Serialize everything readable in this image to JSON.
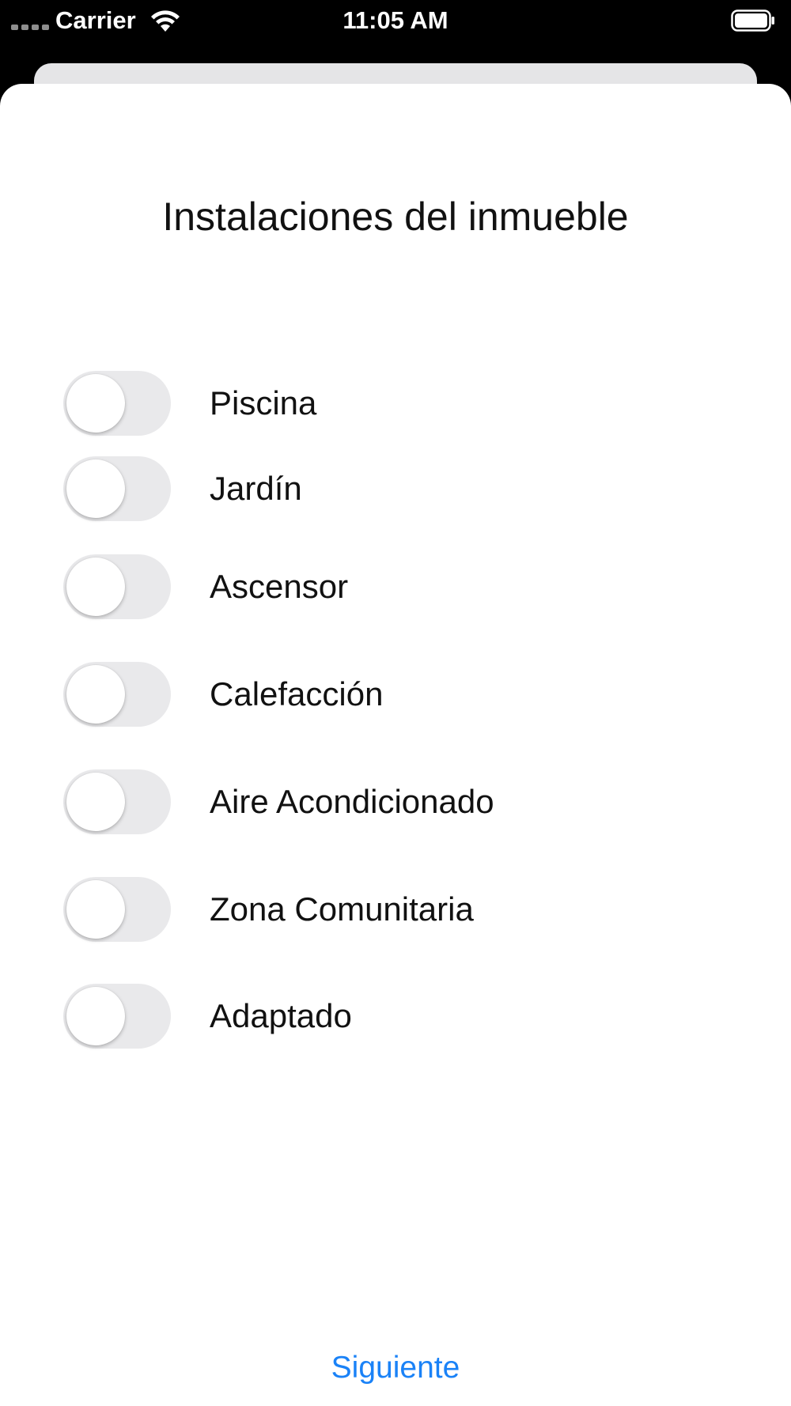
{
  "status_bar": {
    "carrier": "Carrier",
    "time": "11:05 AM",
    "icons": [
      "signal-dots-icon",
      "wifi-icon",
      "battery-icon"
    ]
  },
  "sheet": {
    "title": "Instalaciones del inmueble",
    "toggles": [
      {
        "label": "Piscina",
        "on": false
      },
      {
        "label": "Jardín",
        "on": false
      },
      {
        "label": "Ascensor",
        "on": false
      },
      {
        "label": "Calefacción",
        "on": false
      },
      {
        "label": "Aire Acondicionado",
        "on": false
      },
      {
        "label": "Zona Comunitaria",
        "on": false
      },
      {
        "label": "Adaptado",
        "on": false
      }
    ],
    "next_label": "Siguiente"
  },
  "colors": {
    "accent": "#1a82f7",
    "toggle_off": "#e9e9eb",
    "background": "#000000",
    "sheet": "#ffffff"
  }
}
